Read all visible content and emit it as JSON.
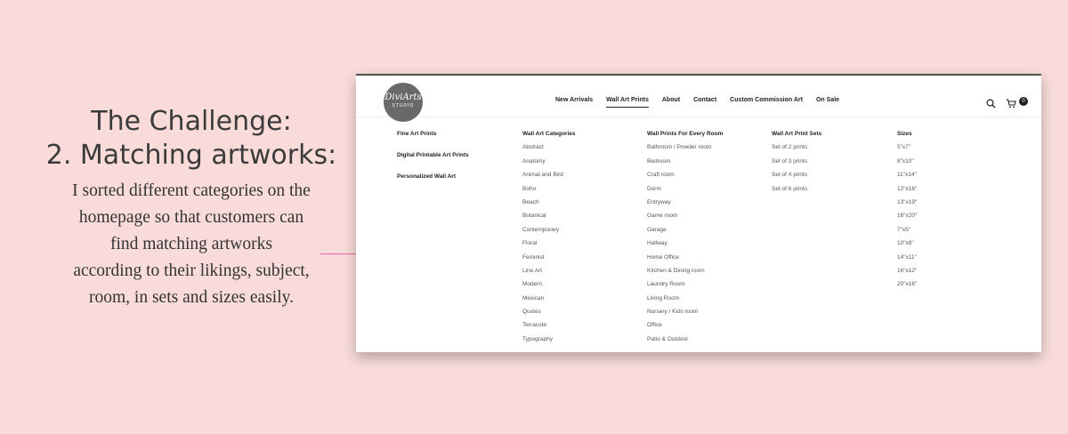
{
  "caption": {
    "title_line1": "The Challenge:",
    "title_line2": "2. Matching artworks:",
    "body_lines": [
      "I sorted different categories on the",
      "homepage so that customers can",
      "find matching artworks",
      "according to their likings, subject,",
      "room, in sets and sizes easily."
    ]
  },
  "logo": {
    "name": "DiviArts",
    "sub": "STUDIO"
  },
  "nav": {
    "items": [
      "New Arrivals",
      "Wall Art Prints",
      "About",
      "Contact",
      "Custom Commission Art",
      "On Sale"
    ],
    "active_index": 1
  },
  "cart": {
    "count": "0"
  },
  "menu": {
    "col0": [
      "Fine Art Prints",
      "Digital Printable Art Prints",
      "Personalized Wall Art"
    ],
    "columns": [
      {
        "title": "Wall Art Categories",
        "items": [
          "Abstract",
          "Anatomy",
          "Animal and Bird",
          "Boho",
          "Beach",
          "Botanical",
          "Contemporary",
          "Floral",
          "Feminist",
          "Line Art",
          "Modern",
          "Mexican",
          "Quotes",
          "Terracote",
          "Typography"
        ]
      },
      {
        "title": "Wall Prints For Every Room",
        "items": [
          "Bathroom / Powder room",
          "Bedroom",
          "Craft room",
          "Dorm",
          "Entryway",
          "Game room",
          "Garage",
          "Hallway",
          "Home Office",
          "Kitchen & Dining room",
          "Laundry Room",
          "Living Room",
          "Nursery / Kids room",
          "Office",
          "Patio & Outdoor"
        ]
      },
      {
        "title": "Wall Art Print Sets",
        "items": [
          "Set of 2 prints",
          "Set of 3 prints",
          "Set of 4 prints",
          "Set of 6 prints"
        ]
      },
      {
        "title": "Sizes",
        "items": [
          "5\"x7\"",
          "8\"x10\"",
          "11\"x14\"",
          "12\"x16\"",
          "13\"x19\"",
          "16\"x20\"",
          "7\"x5\"",
          "10\"x8\"",
          "14\"x11\"",
          "16\"x12\"",
          "20\"x16\""
        ]
      }
    ]
  }
}
